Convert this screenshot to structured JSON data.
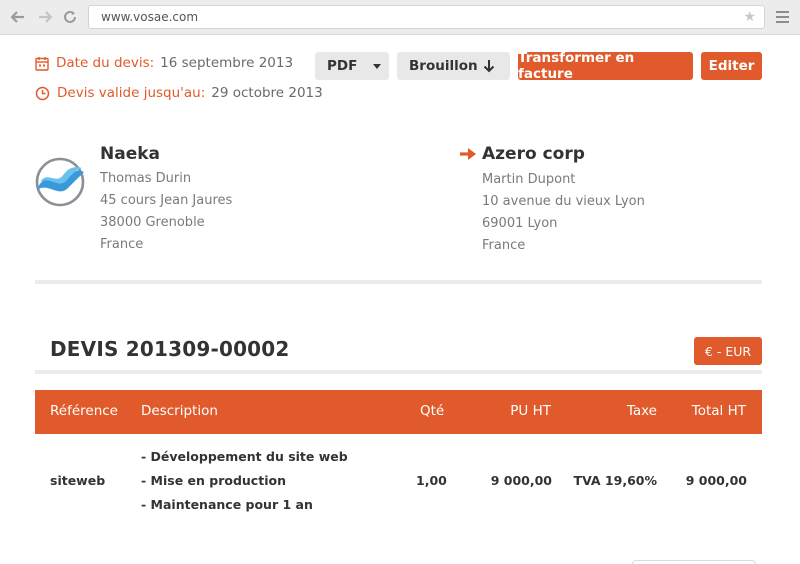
{
  "browser": {
    "url": "www.vosae.com",
    "back_icon": "arrow-left-icon",
    "forward_icon": "arrow-right-icon",
    "reload_icon": "reload-icon",
    "star_icon": "star-icon",
    "menu_icon": "hamburger-menu-icon"
  },
  "quote_meta": {
    "date_label": "Date du devis:",
    "date_value": "16 septembre 2013",
    "valid_label": "Devis valide jusqu'au:",
    "valid_value": "29 octobre 2013",
    "date_icon": "calendar-icon",
    "valid_icon": "clock-icon"
  },
  "toolbar": {
    "pdf_label": "PDF",
    "status_label": "Brouillon",
    "transform_label": "Transformer en facture",
    "edit_label": "Editer"
  },
  "sender": {
    "name": "Naeka",
    "contact": "Thomas Durin",
    "address": "45 cours Jean Jaures",
    "city": "38000 Grenoble",
    "country": "France",
    "logo_icon": "naeka-logo"
  },
  "recipient": {
    "name": "Azero corp",
    "contact": "Martin Dupont",
    "address": "10 avenue du vieux Lyon",
    "city": "69001 Lyon",
    "country": "France",
    "arrow_icon": "arrow-right-icon"
  },
  "document": {
    "title": "DEVIS 201309-00002",
    "currency": "€ - EUR"
  },
  "table": {
    "headers": [
      "Référence",
      "Description",
      "Qté",
      "PU HT",
      "Taxe",
      "Total HT"
    ],
    "rows": [
      {
        "reference": "siteweb",
        "description": [
          "- Développement du site web",
          "- Mise en production",
          "- Maintenance pour 1 an"
        ],
        "quantity": "1,00",
        "unit_price": "9 000,00",
        "tax": "TVA 19,60%",
        "total": "9 000,00"
      }
    ]
  },
  "colors": {
    "accent": "#e05a2b",
    "header_bg": "#e05a2b",
    "button_grey": "#e8e8e8"
  }
}
